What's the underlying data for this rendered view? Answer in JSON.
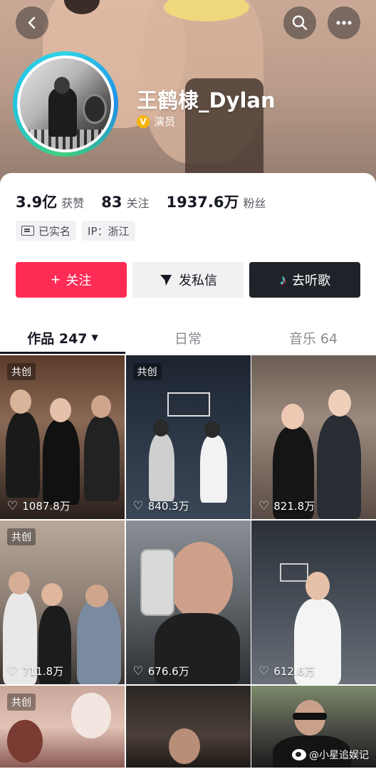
{
  "header": {
    "username": "王鹤棣_Dylan",
    "verification": "演员",
    "verify_icon_glyph": "V"
  },
  "stats": [
    {
      "value": "3.9亿",
      "label": "获赞"
    },
    {
      "value": "83",
      "label": "关注"
    },
    {
      "value": "1937.6万",
      "label": "粉丝"
    }
  ],
  "tags": {
    "realname": "已实名",
    "ip": "IP：浙江"
  },
  "actions": {
    "follow": "关注",
    "message": "发私信",
    "music": "去听歌"
  },
  "tabs": [
    {
      "label": "作品 247",
      "active": true
    },
    {
      "label": "日常",
      "active": false
    },
    {
      "label": "音乐 64",
      "active": false
    }
  ],
  "grid": [
    {
      "badge": "共创",
      "likes": "1087.8万"
    },
    {
      "badge": "共创",
      "likes": "840.3万"
    },
    {
      "badge": "",
      "likes": "821.8万"
    },
    {
      "badge": "共创",
      "likes": "711.8万"
    },
    {
      "badge": "",
      "likes": "676.6万"
    },
    {
      "badge": "",
      "likes": "612.6万"
    },
    {
      "badge": "共创",
      "likes": ""
    },
    {
      "badge": "",
      "likes": ""
    },
    {
      "badge": "",
      "likes": ""
    }
  ],
  "watermark": "@小星追娱记",
  "colors": {
    "accent": "#fe2c55",
    "dark_button": "#1f2329",
    "verify": "#f7b500"
  },
  "icons": [
    "back-icon",
    "search-icon",
    "more-icon",
    "plus-icon",
    "send-icon",
    "music-note-icon",
    "heart-icon",
    "idcard-icon",
    "caret-down-icon"
  ]
}
